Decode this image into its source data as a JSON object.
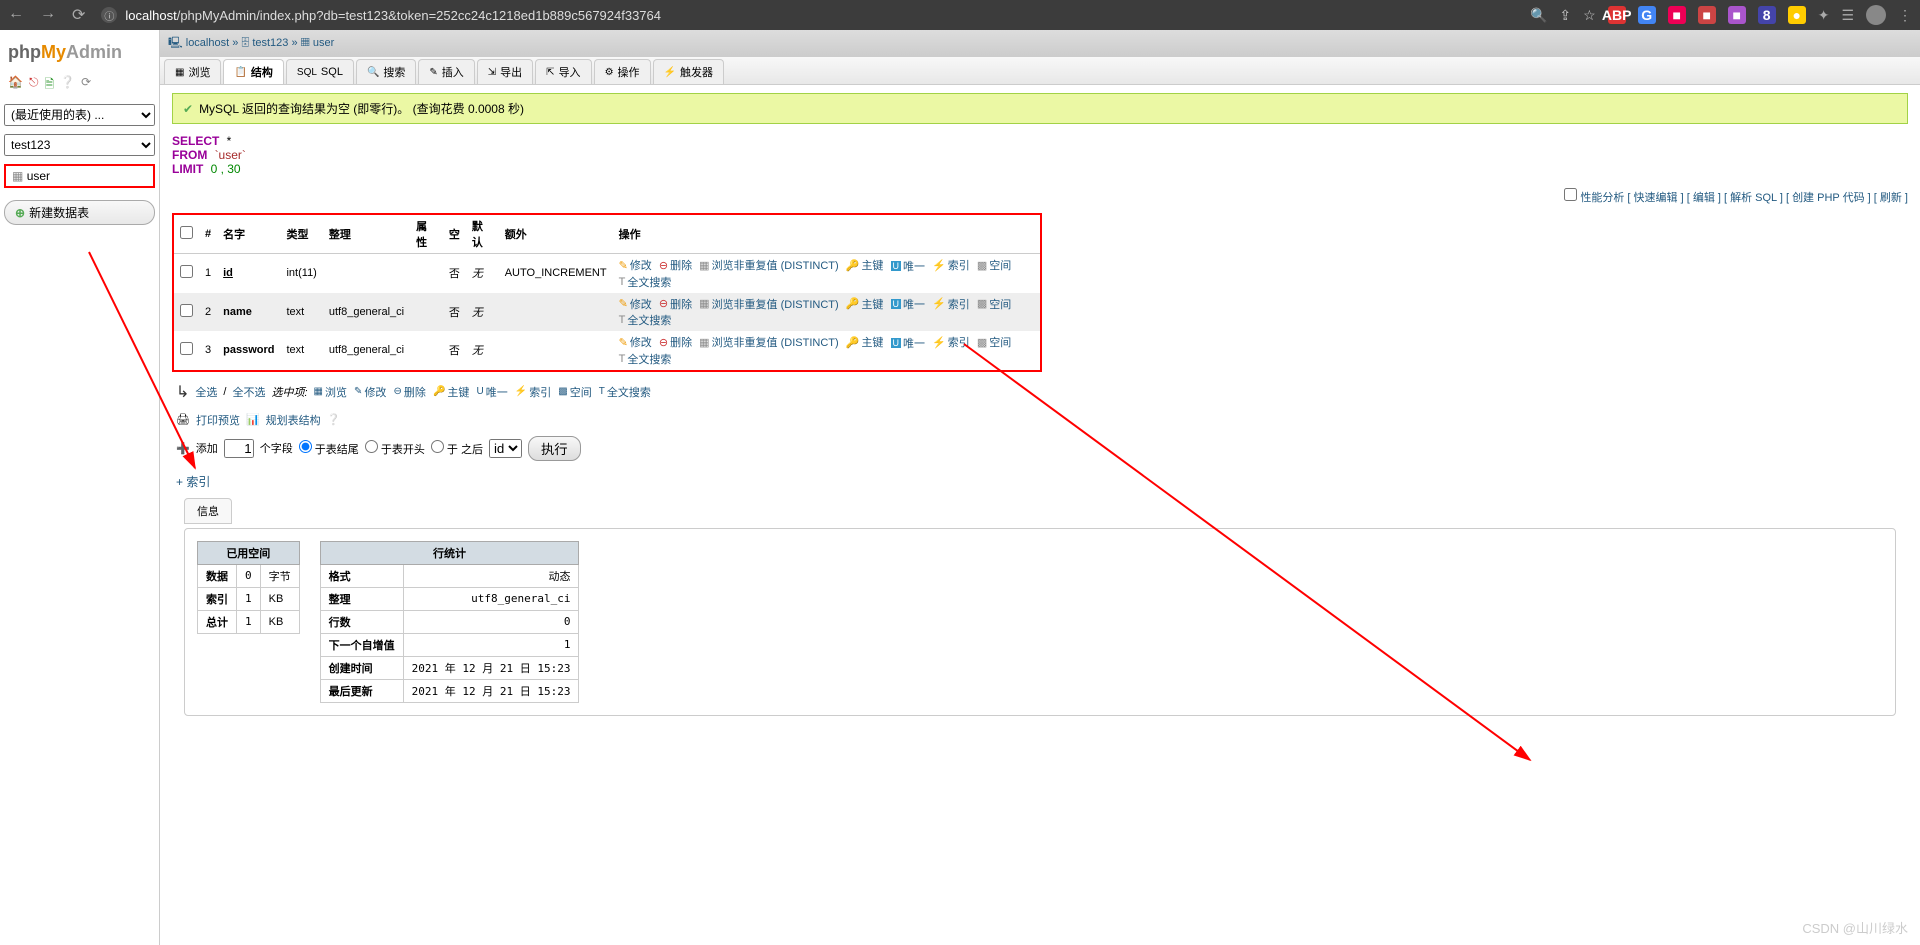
{
  "browser": {
    "url_host": "localhost",
    "url_path": "/phpMyAdmin/index.php?db=test123&token=252cc24c1218ed1b889c567924f33764"
  },
  "logo": {
    "php": "php",
    "my": "My",
    "admin": "Admin"
  },
  "sidebar": {
    "recent_select": "(最近使用的表) ...",
    "db_select": "test123",
    "table_name": "user",
    "new_table": "新建数据表"
  },
  "breadcrumb": {
    "server": "localhost",
    "db": "test123",
    "table": "user"
  },
  "tabs": [
    "浏览",
    "结构",
    "SQL",
    "搜索",
    "插入",
    "导出",
    "导入",
    "操作",
    "触发器"
  ],
  "tabs_active_index": 1,
  "success_msg": "MySQL 返回的查询结果为空 (即零行)。 (查询花费 0.0008 秒)",
  "sql": {
    "select": "SELECT",
    "star": "*",
    "from": "FROM",
    "table": "`user`",
    "limit": "LIMIT",
    "nums": "0 , 30"
  },
  "linkbar": {
    "perf_cb": "性能分析",
    "links": [
      "快速编辑",
      "编辑",
      "解析 SQL",
      "创建 PHP 代码",
      "刷新"
    ]
  },
  "struct": {
    "headers": [
      "#",
      "名字",
      "类型",
      "整理",
      "属性",
      "空",
      "默认",
      "额外",
      "操作"
    ],
    "rows": [
      {
        "n": "1",
        "name": "id",
        "type": "int(11)",
        "coll": "",
        "attr": "",
        "null": "否",
        "def": "无",
        "extra": "AUTO_INCREMENT"
      },
      {
        "n": "2",
        "name": "name",
        "type": "text",
        "coll": "utf8_general_ci",
        "attr": "",
        "null": "否",
        "def": "无",
        "extra": ""
      },
      {
        "n": "3",
        "name": "password",
        "type": "text",
        "coll": "utf8_general_ci",
        "attr": "",
        "null": "否",
        "def": "无",
        "extra": ""
      }
    ],
    "actions": {
      "edit": "修改",
      "drop": "删除",
      "browse": "浏览非重复值 (DISTINCT)",
      "primary": "主键",
      "unique": "唯一",
      "index": "索引",
      "spatial": "空间",
      "fulltext": "全文搜索"
    }
  },
  "bulk": {
    "check_all": "全选",
    "uncheck_all": "全不选",
    "with_selected": "选中项:",
    "items": [
      "浏览",
      "修改",
      "删除",
      "主键",
      "唯一",
      "索引",
      "空间",
      "全文搜索"
    ]
  },
  "tools": {
    "print": "打印预览",
    "schema": "规划表结构"
  },
  "add": {
    "label": "添加",
    "count": "1",
    "field": "个字段",
    "opts": [
      "于表结尾",
      "于表开头",
      "于 之后"
    ],
    "column_select": "id",
    "go": "执行"
  },
  "index": {
    "plus": "+",
    "label": "索引"
  },
  "info_tab": "信息",
  "space": {
    "title": "已用空间",
    "rows": [
      {
        "k": "数据",
        "v": "0",
        "u": "字节"
      },
      {
        "k": "索引",
        "v": "1",
        "u": "KB"
      },
      {
        "k": "总计",
        "v": "1",
        "u": "KB"
      }
    ]
  },
  "rowstats": {
    "title": "行统计",
    "rows": [
      {
        "k": "格式",
        "v": "动态"
      },
      {
        "k": "整理",
        "v": "utf8_general_ci"
      },
      {
        "k": "行数",
        "v": "0"
      },
      {
        "k": "下一个自增值",
        "v": "1"
      },
      {
        "k": "创建时间",
        "v": "2021 年 12 月 21 日 15:23"
      },
      {
        "k": "最后更新",
        "v": "2021 年 12 月 21 日 15:23"
      }
    ]
  },
  "watermark": "CSDN @山川绿水"
}
